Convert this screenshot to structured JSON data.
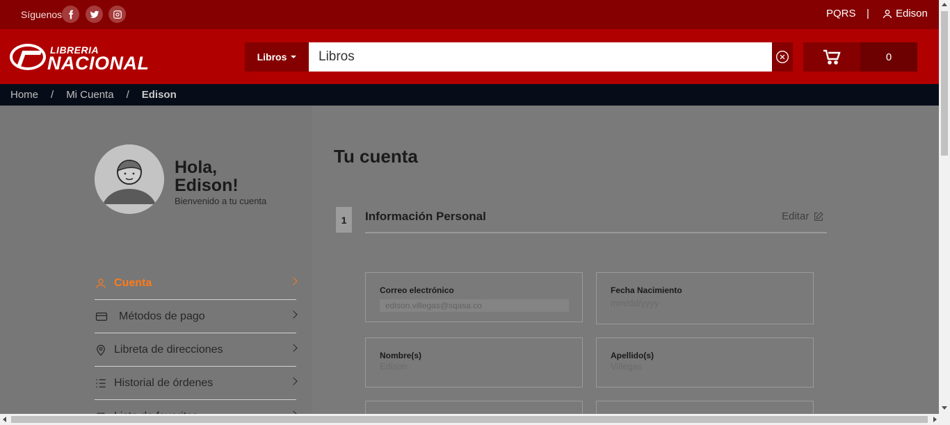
{
  "topbar": {
    "follow": "Síguenos",
    "social": [
      "facebook-icon",
      "twitter-icon",
      "instagram-icon"
    ],
    "pqrs": "PQRS",
    "separator": "|",
    "user": "Edison"
  },
  "header": {
    "logo_top": "LIBRERIA",
    "logo_bottom": "NACIONAL",
    "category": "Libros",
    "search_value": "Libros",
    "cart_count": "0"
  },
  "breadcrumb": [
    "Home",
    "/",
    "Mi Cuenta",
    "/",
    "Edison"
  ],
  "profile": {
    "greeting_line1": "Hola,",
    "greeting_line2": "Edison!",
    "welcome": "Bienvenido a tu cuenta"
  },
  "menu": [
    {
      "label": "Cuenta",
      "icon": "user-icon",
      "active": true
    },
    {
      "label": "Métodos de pago",
      "icon": "credit-card-icon",
      "active": false
    },
    {
      "label": "Libreta de direcciones",
      "icon": "location-pin-icon",
      "active": false
    },
    {
      "label": "Historial de órdenes",
      "icon": "list-icon",
      "active": false
    },
    {
      "label": "Lista de favoritos",
      "icon": "heart-icon",
      "active": false
    }
  ],
  "main": {
    "title": "Tu cuenta",
    "step": "1",
    "section": "Información Personal",
    "edit": "Editar",
    "fields": [
      {
        "label": "Correo electrónico",
        "value": "edison.villegas@sqasa.co"
      },
      {
        "label": "Fecha Nacimiento",
        "value": "mm/dd/yyyy"
      },
      {
        "label": "Nombre(s)",
        "value": "Edison"
      },
      {
        "label": "Apellido(s)",
        "value": "Villegas"
      }
    ]
  },
  "colors": {
    "topbar": "#850000",
    "header": "#b10000",
    "accent": "#ff7a1a",
    "breadcrumb_bg": "#070d18"
  }
}
